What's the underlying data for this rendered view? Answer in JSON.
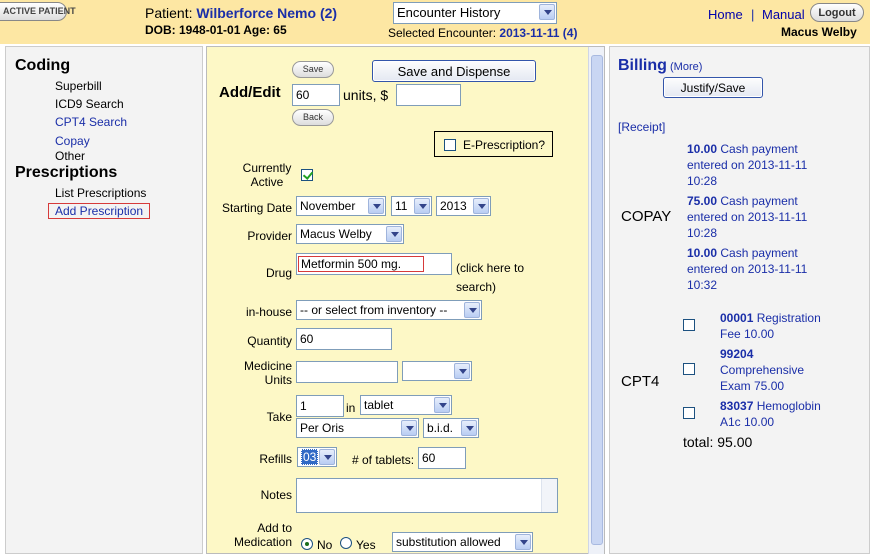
{
  "header": {
    "active_patient_btn": "ACTIVE PATIENT",
    "patient_label": "Patient: ",
    "patient_name": "Wilberforce Nemo (2)",
    "dob_line": "DOB: 1948-01-01 Age: 65",
    "encounter_select": "Encounter History",
    "selected_encounter_label": "Selected Encounter: ",
    "selected_encounter_value": "2013-11-11 (4)",
    "home": "Home",
    "separator": "|",
    "manual": "Manual",
    "logout": "Logout",
    "user": "Macus Welby"
  },
  "nav": {
    "coding_head": "Coding",
    "coding_items": [
      "Superbill",
      "ICD9 Search",
      "CPT4 Search",
      "Copay",
      "Other"
    ],
    "prescriptions_head": "Prescriptions",
    "prescription_items": [
      "List Prescriptions",
      "Add Prescription"
    ]
  },
  "form": {
    "save_btn": "Save",
    "save_dispense_btn": "Save and Dispense",
    "add_edit_label": "Add/Edit",
    "units_value": "60",
    "units_label": "units, $",
    "back_btn": "Back",
    "eprescription_label": "E-Prescription?",
    "currently_active_label": "Currently Active",
    "starting_date_label": "Starting Date",
    "start_month": "November",
    "start_day": "11",
    "start_year": "2013",
    "provider_label": "Provider",
    "provider_value": "Macus Welby",
    "drug_label": "Drug",
    "drug_value": "Metformin 500 mg.",
    "drug_hint": "(click here to search)",
    "inhouse_label": "in-house",
    "inhouse_value": "-- or select from inventory --",
    "quantity_label": "Quantity",
    "quantity_value": "60",
    "medicine_units_label": "Medicine Units",
    "take_label": "Take",
    "take_value": "1",
    "in_label": "in",
    "form_value": "tablet",
    "route_value": "Per Oris",
    "interval_value": "b.i.d.",
    "refills_label": "Refills",
    "refills_value": "03",
    "tablets_label": "# of tablets:",
    "tablets_value": "60",
    "notes_label": "Notes",
    "add_to_med_label": "Add to Medication",
    "no_label": "No",
    "yes_label": "Yes",
    "substitution_value": "substitution allowed"
  },
  "billing": {
    "title": "Billing",
    "more": "(More)",
    "justify_btn": "Justify/Save",
    "receipt": "[Receipt]",
    "copay_label": "COPAY",
    "copay_entries": [
      {
        "amount": "10.00",
        "line1": "Cash payment",
        "line2": "entered on 2013-11-11",
        "line3": "10:28"
      },
      {
        "amount": "75.00",
        "line1": "Cash payment",
        "line2": "entered on 2013-11-11",
        "line3": "10:28"
      },
      {
        "amount": "10.00",
        "line1": "Cash payment",
        "line2": "entered on 2013-11-11",
        "line3": "10:32"
      }
    ],
    "cpt4_label": "CPT4",
    "cpt4_entries": [
      {
        "code": "00001",
        "line1": "Registration",
        "line2": "Fee 10.00"
      },
      {
        "code": "99204",
        "line1": "Comprehensive",
        "line2": "Exam 75.00"
      },
      {
        "code": "83037",
        "line1": "Hemoglobin",
        "line2": "A1c 10.00"
      }
    ],
    "total": "total: 95.00"
  }
}
